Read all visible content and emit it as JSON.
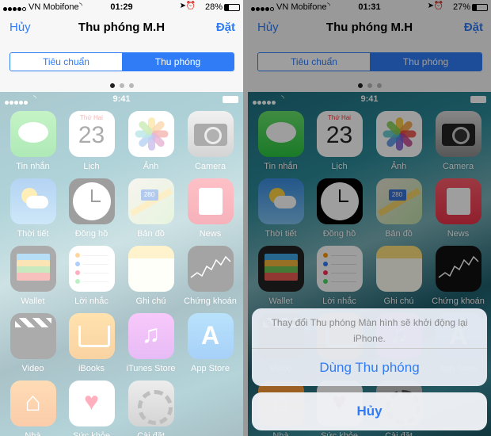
{
  "screens": [
    {
      "status": {
        "carrier": "VN Mobifone",
        "time": "01:29",
        "battery": "28%",
        "battery_level": 0.28
      },
      "nav": {
        "left": "Hủy",
        "title": "Thu phóng M.H",
        "right": "Đặt"
      },
      "segments": [
        "Tiêu chuẩn",
        "Thu phóng"
      ],
      "selected_segment": 1,
      "preview_time": "9:41"
    },
    {
      "status": {
        "carrier": "VN Mobifone",
        "time": "01:31",
        "battery": "27%",
        "battery_level": 0.27
      },
      "nav": {
        "left": "Hủy",
        "title": "Thu phóng M.H",
        "right": "Đặt"
      },
      "segments": [
        "Tiêu chuẩn",
        "Thu phóng"
      ],
      "selected_segment": 1,
      "preview_time": "9:41",
      "action_sheet": {
        "message": "Thay đổi Thu phóng Màn hình sẽ khởi động lại iPhone.",
        "action": "Dùng Thu phóng",
        "cancel": "Hủy"
      }
    }
  ],
  "calendar": {
    "weekday": "Thứ Hai",
    "day": "23"
  },
  "maps_sign": "280",
  "apps": [
    {
      "label": "Tin nhắn",
      "icon": "messages-icon"
    },
    {
      "label": "Lịch",
      "icon": "calendar-icon"
    },
    {
      "label": "Ảnh",
      "icon": "photos-icon"
    },
    {
      "label": "Camera",
      "icon": "camera-icon"
    },
    {
      "label": "Thời tiết",
      "icon": "weather-icon"
    },
    {
      "label": "Đồng hồ",
      "icon": "clock-icon"
    },
    {
      "label": "Bản đồ",
      "icon": "maps-icon"
    },
    {
      "label": "News",
      "icon": "news-icon"
    },
    {
      "label": "Wallet",
      "icon": "wallet-icon"
    },
    {
      "label": "Lời nhắc",
      "icon": "reminders-icon"
    },
    {
      "label": "Ghi chú",
      "icon": "notes-icon"
    },
    {
      "label": "Chứng khoán",
      "icon": "stocks-icon"
    },
    {
      "label": "Video",
      "icon": "video-icon"
    },
    {
      "label": "iBooks",
      "icon": "ibooks-icon"
    },
    {
      "label": "iTunes Store",
      "icon": "itunes-icon"
    },
    {
      "label": "App Store",
      "icon": "appstore-icon"
    },
    {
      "label": "Nhà",
      "icon": "home-icon"
    },
    {
      "label": "Sức khỏe",
      "icon": "health-icon"
    },
    {
      "label": "Cài đặt",
      "icon": "settings-icon"
    }
  ],
  "colors": {
    "accent": "#2f7cf6",
    "segment_active_dim": "#7a7a7a"
  }
}
